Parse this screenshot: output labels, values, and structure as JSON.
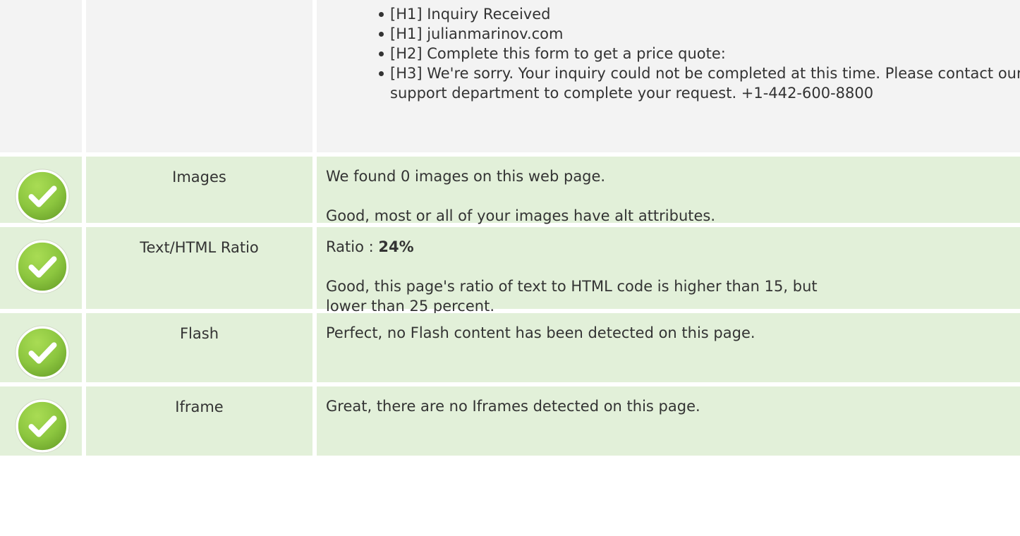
{
  "headings": {
    "items": [
      "[H1] Inquiry Received",
      "[H1] julianmarinov.com",
      "[H2] Complete this form to get a price quote:",
      "[H3] We're sorry. Your inquiry could not be completed at this time. Please contact our support department to complete your request. +1-442-600-8800"
    ]
  },
  "checks": [
    {
      "icon": "check-circle-icon",
      "label": "Images",
      "line1": "We found 0 images on this web page.",
      "line2": "Good, most or all of your images have alt attributes."
    },
    {
      "icon": "check-circle-icon",
      "label": "Text/HTML Ratio",
      "line1_prefix": "Ratio : ",
      "line1_value": "24%",
      "line2": "Good, this page's ratio of text to HTML code is higher than 15, but lower than 25 percent."
    },
    {
      "icon": "check-circle-icon",
      "label": "Flash",
      "line1": "Perfect, no Flash content has been detected on this page."
    },
    {
      "icon": "check-circle-icon",
      "label": "Iframe",
      "line1": "Great, there are no Iframes detected on this page."
    }
  ],
  "colors": {
    "pass_green": "#8cc63f",
    "row_green": "#e2f0d9",
    "row_grey": "#f3f3f3"
  }
}
